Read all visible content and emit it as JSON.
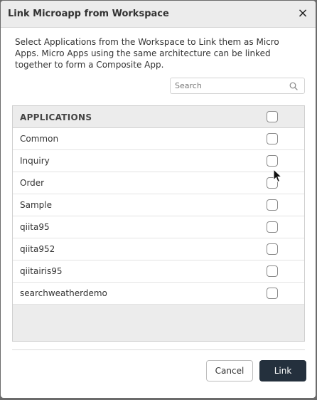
{
  "dialog": {
    "title": "Link Microapp from Workspace",
    "close_glyph": "×",
    "description": "Select Applications from the Workspace to Link them as Micro Apps. Micro Apps using the same architecture can be linked together to form a Composite App."
  },
  "search": {
    "placeholder": "Search",
    "value": "",
    "icon": "search-icon"
  },
  "table": {
    "header": "APPLICATIONS",
    "rows": [
      {
        "name": "Common",
        "checked": false
      },
      {
        "name": "Inquiry",
        "checked": false
      },
      {
        "name": "Order",
        "checked": false
      },
      {
        "name": "Sample",
        "checked": false
      },
      {
        "name": "qiita95",
        "checked": false
      },
      {
        "name": "qiita952",
        "checked": false
      },
      {
        "name": "qiitairis95",
        "checked": false
      },
      {
        "name": "searchweatherdemo",
        "checked": false
      }
    ]
  },
  "buttons": {
    "cancel": "Cancel",
    "link": "Link"
  },
  "colors": {
    "primary_button": "#24303d",
    "header_bg": "#ececec",
    "overlay": "#6b6b6b"
  }
}
